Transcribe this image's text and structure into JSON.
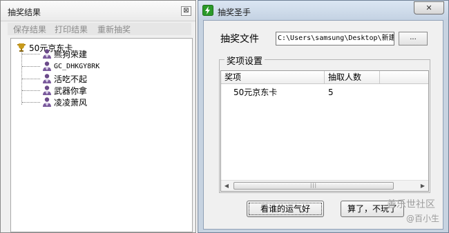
{
  "left_window": {
    "title": "抽奖结果",
    "close_label": "⊠",
    "toolbar": {
      "save_label": "保存结果",
      "print_label": "打印结果",
      "redraw_label": "重新抽奖"
    },
    "tree": {
      "root_label": "50元京东卡",
      "items": [
        {
          "label": "熊狗荣建"
        },
        {
          "label": "GC_DHKGY8RK"
        },
        {
          "label": "活吃不起"
        },
        {
          "label": "武器你拿"
        },
        {
          "label": "凌凌萧风"
        }
      ]
    }
  },
  "right_window": {
    "title": "抽奖圣手",
    "close_label": "✕",
    "file_label": "抽奖文件",
    "file_path": "C:\\Users\\samsung\\Desktop\\新建",
    "browse_label": "...",
    "group_label": "奖项设置",
    "columns": [
      "奖项",
      "抽取人数"
    ],
    "rows": [
      {
        "prize": "50元京东卡",
        "count": "5"
      }
    ],
    "scroll_left": "◀",
    "scroll_right": "▶",
    "scroll_grip": "|||",
    "primary_button": "看谁的运气好",
    "secondary_button": "算了，不玩了"
  },
  "watermark": {
    "line1": "善乐世社区",
    "line2": "@百小生"
  },
  "colors": {
    "window_frame": "#c7d3e1",
    "client_bg": "#f0f0f0",
    "trophy": "#c89a1a",
    "app_icon": "#2a9a2a"
  }
}
